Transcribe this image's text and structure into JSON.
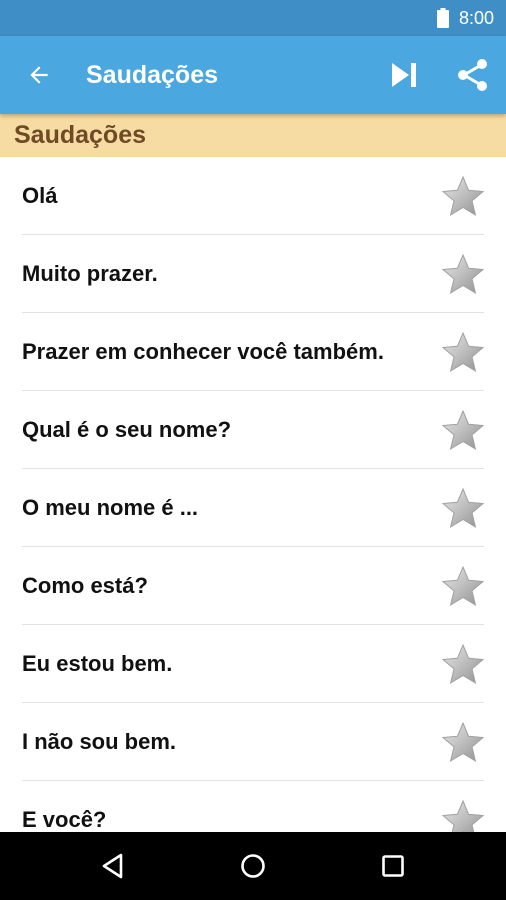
{
  "status_bar": {
    "time": "8:00",
    "icons": [
      "battery-icon"
    ]
  },
  "app_bar": {
    "title": "Saudações",
    "icons": [
      "arrow-left-icon",
      "skip-next-icon",
      "share-icon"
    ]
  },
  "section": {
    "title": "Saudações"
  },
  "phrases": [
    {
      "text": "Olá"
    },
    {
      "text": "Muito prazer."
    },
    {
      "text": "Prazer em conhecer você também."
    },
    {
      "text": "Qual é o seu nome?"
    },
    {
      "text": "O meu nome é ..."
    },
    {
      "text": "Como está?"
    },
    {
      "text": "Eu estou bem."
    },
    {
      "text": "I não sou bem."
    },
    {
      "text": "E você?"
    }
  ],
  "nav_bar": {
    "icons": [
      "back-triangle-icon",
      "home-circle-icon",
      "recents-square-icon"
    ]
  },
  "colors": {
    "status_bar": "#3f8ec6",
    "app_bar": "#4aa7df",
    "section_header": "#f6dba2",
    "section_text": "#6f4a26",
    "nav_bar": "#000000"
  }
}
